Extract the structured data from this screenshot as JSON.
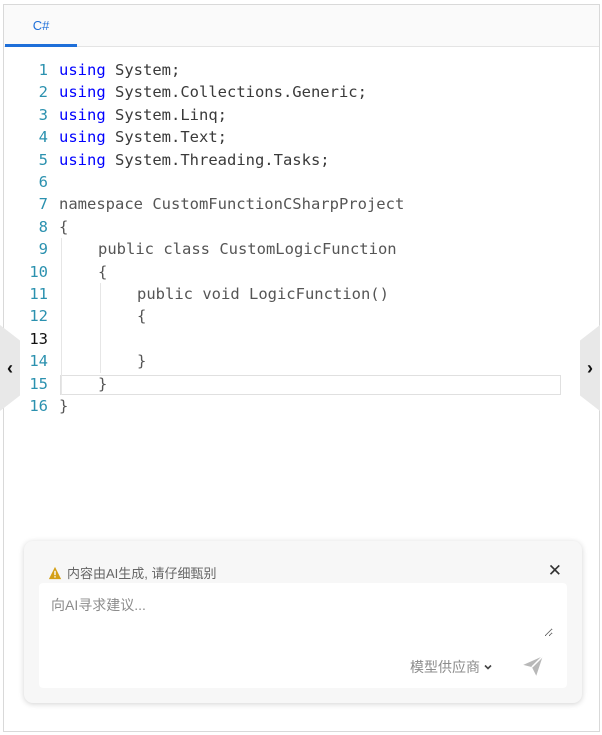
{
  "tabs": [
    {
      "label": "C#",
      "active": true
    }
  ],
  "editor": {
    "active_line": 13,
    "lines": [
      {
        "n": "1",
        "indent": 0,
        "tokens": [
          {
            "t": "using",
            "kw": true
          },
          {
            "t": " System;"
          }
        ]
      },
      {
        "n": "2",
        "indent": 0,
        "tokens": [
          {
            "t": "using",
            "kw": true
          },
          {
            "t": " System.Collections.Generic;"
          }
        ]
      },
      {
        "n": "3",
        "indent": 0,
        "tokens": [
          {
            "t": "using",
            "kw": true
          },
          {
            "t": " System.Linq;"
          }
        ]
      },
      {
        "n": "4",
        "indent": 0,
        "tokens": [
          {
            "t": "using",
            "kw": true
          },
          {
            "t": " System.Text;"
          }
        ]
      },
      {
        "n": "5",
        "indent": 0,
        "tokens": [
          {
            "t": "using",
            "kw": true
          },
          {
            "t": " System.Threading.Tasks;"
          }
        ]
      },
      {
        "n": "6",
        "indent": 0,
        "tokens": []
      },
      {
        "n": "7",
        "indent": 0,
        "tokens": [
          {
            "t": "namespace CustomFunctionCSharpProject",
            "plain": true
          }
        ]
      },
      {
        "n": "8",
        "indent": 0,
        "tokens": [
          {
            "t": "{",
            "plain": true
          }
        ]
      },
      {
        "n": "9",
        "indent": 1,
        "tokens": [
          {
            "t": "public class CustomLogicFunction",
            "plain": true
          }
        ]
      },
      {
        "n": "10",
        "indent": 1,
        "tokens": [
          {
            "t": "{",
            "plain": true
          }
        ]
      },
      {
        "n": "11",
        "indent": 2,
        "tokens": [
          {
            "t": "public void LogicFunction()",
            "plain": true
          }
        ]
      },
      {
        "n": "12",
        "indent": 2,
        "tokens": [
          {
            "t": "{",
            "plain": true
          }
        ]
      },
      {
        "n": "13",
        "indent": 2,
        "tokens": []
      },
      {
        "n": "14",
        "indent": 2,
        "tokens": [
          {
            "t": "}",
            "plain": true
          }
        ]
      },
      {
        "n": "15",
        "indent": 1,
        "tokens": [
          {
            "t": "}",
            "plain": true
          }
        ]
      },
      {
        "n": "16",
        "indent": 0,
        "tokens": [
          {
            "t": "}",
            "plain": true
          }
        ]
      }
    ]
  },
  "nav": {
    "prev_icon": "chevron-left-icon",
    "prev_glyph": "‹",
    "next_icon": "chevron-right-icon",
    "next_glyph": "›"
  },
  "ai_panel": {
    "warning_text": "内容由AI生成, 请仔细甄别",
    "close_glyph": "✕",
    "input_placeholder": "向AI寻求建议...",
    "input_value": "",
    "model_provider_label": "模型供应商",
    "warning_color": "#d4a017"
  }
}
